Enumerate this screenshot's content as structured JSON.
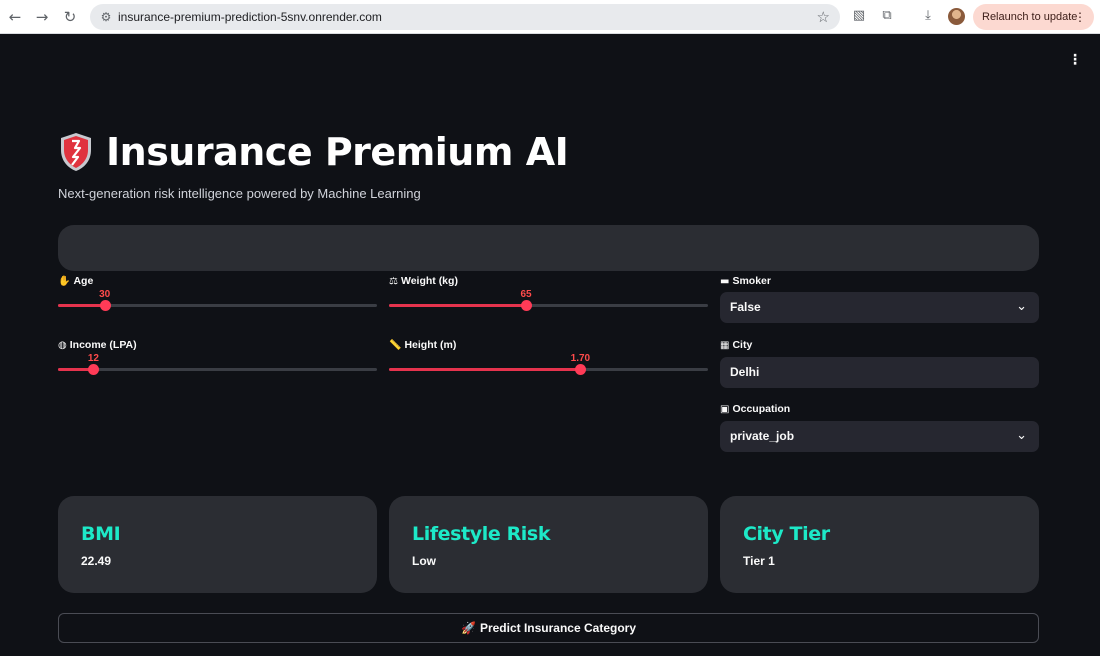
{
  "browser": {
    "url": "insurance-premium-prediction-5snv.onrender.com",
    "relaunch_label": "Relaunch to update"
  },
  "app": {
    "title": "Insurance Premium AI",
    "subtitle": "Next-generation risk intelligence powered by Machine Learning"
  },
  "inputs": {
    "age": {
      "label": "Age",
      "value": 30,
      "min": 18,
      "max": 100,
      "display": "30"
    },
    "weight": {
      "label": "Weight (kg)",
      "value": 65,
      "min": 1,
      "max": 150,
      "display": "65"
    },
    "income": {
      "label": "Income (LPA)",
      "value": 12,
      "min": 1,
      "max": 100,
      "display": "12"
    },
    "height": {
      "label": "Height (m)",
      "value": 1.7,
      "min": 0.5,
      "max": 2.5,
      "display": "1.70"
    },
    "smoker": {
      "label": "Smoker",
      "value": "False"
    },
    "city": {
      "label": "City",
      "value": "Delhi"
    },
    "occupation": {
      "label": "Occupation",
      "value": "private_job"
    }
  },
  "metrics": [
    {
      "title": "BMI",
      "value": "22.49"
    },
    {
      "title": "Lifestyle Risk",
      "value": "Low"
    },
    {
      "title": "City Tier",
      "value": "Tier 1"
    }
  ],
  "predict_button": {
    "label": "Predict Insurance Category"
  },
  "colors": {
    "accent": "#ff4b4b",
    "metric_title": "#1de9c8",
    "background": "#0f1116",
    "card": "#2b2d33"
  }
}
